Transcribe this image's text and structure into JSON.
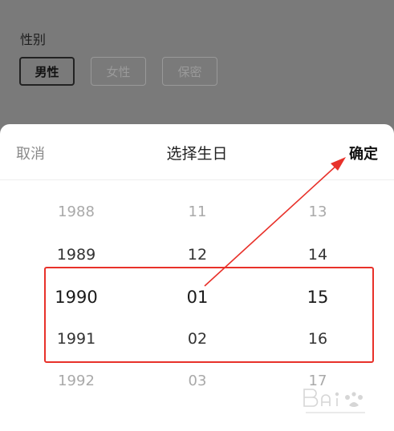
{
  "gender": {
    "label": "性别",
    "options": [
      "男性",
      "女性",
      "保密"
    ],
    "selected": "男性"
  },
  "picker": {
    "cancel_label": "取消",
    "title": "选择生日",
    "confirm_label": "确定",
    "years": [
      "1988",
      "1989",
      "1990",
      "1991",
      "1992"
    ],
    "months": [
      "11",
      "12",
      "01",
      "02",
      "03"
    ],
    "days": [
      "13",
      "14",
      "15",
      "16",
      "17"
    ]
  },
  "colors": {
    "annotation": "#e8312a",
    "overlay": "#7a7a7a"
  }
}
